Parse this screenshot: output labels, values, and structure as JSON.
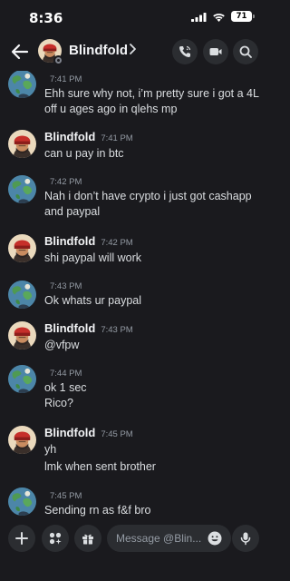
{
  "status_bar": {
    "time": "8:36",
    "battery": "71"
  },
  "header": {
    "name": "Blindfold"
  },
  "composer": {
    "placeholder": "Message @Blin..."
  },
  "colors": {
    "background": "#1a1a1e",
    "button": "#2b2d31",
    "timestamp": "#949ba4"
  },
  "messages": [
    {
      "author": "",
      "time": "7:41 PM",
      "lines": [
        "Ehh sure why not, i’m pretty sure i got a 4L",
        "off u ages ago in qlehs mp"
      ]
    },
    {
      "author": "Blindfold",
      "time": "7:41 PM",
      "lines": [
        "can u pay in btc"
      ]
    },
    {
      "author": "",
      "time": "7:42 PM",
      "lines": [
        "Nah i don’t have crypto i just got cashapp",
        "and paypal"
      ]
    },
    {
      "author": "Blindfold",
      "time": "7:42 PM",
      "lines": [
        "shi paypal will work"
      ]
    },
    {
      "author": "",
      "time": "7:43 PM",
      "lines": [
        "Ok whats ur paypal"
      ]
    },
    {
      "author": "Blindfold",
      "time": "7:43 PM",
      "lines": [
        "@vfpw"
      ]
    },
    {
      "author": "",
      "time": "7:44 PM",
      "lines": [
        "ok 1 sec",
        "Rico?"
      ]
    },
    {
      "author": "Blindfold",
      "time": "7:45 PM",
      "lines": [
        "yh",
        "lmk when sent brother"
      ]
    },
    {
      "author": "",
      "time": "7:45 PM",
      "lines": [
        "Sending rn as f&f bro"
      ]
    }
  ]
}
